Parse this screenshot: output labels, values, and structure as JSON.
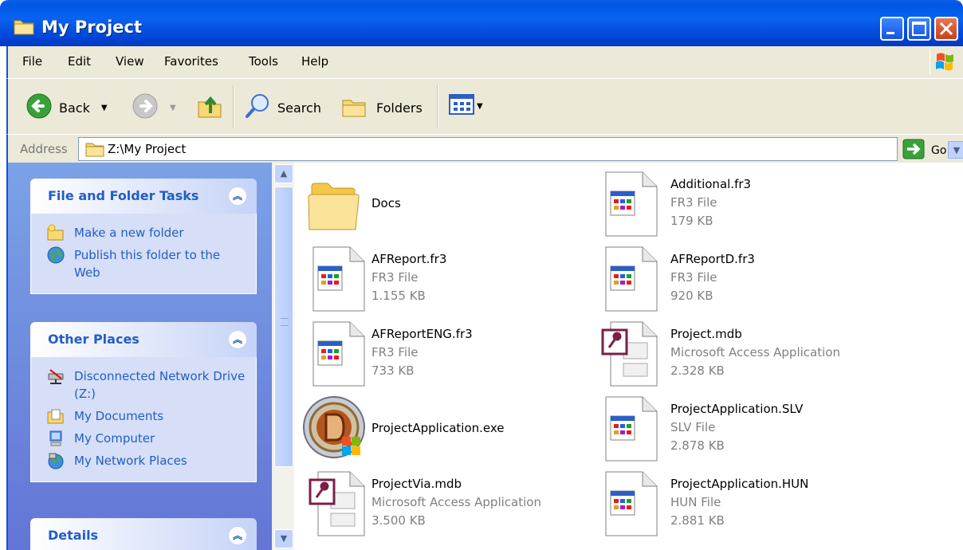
{
  "window": {
    "title": "My Project"
  },
  "menu": {
    "items": [
      "File",
      "Edit",
      "View",
      "Favorites",
      "Tools",
      "Help"
    ]
  },
  "toolbar": {
    "back_label": "Back",
    "search_label": "Search",
    "folders_label": "Folders"
  },
  "address": {
    "label": "Address",
    "value": "Z:\\My Project",
    "go_label": "Go"
  },
  "taskpane": {
    "file_tasks": {
      "title": "File and Folder Tasks",
      "items": [
        "Make a new folder",
        "Publish this folder to the Web"
      ]
    },
    "other_places": {
      "title": "Other Places",
      "items": [
        "Disconnected Network Drive (Z:)",
        "My Documents",
        "My Computer",
        "My Network Places"
      ]
    },
    "details": {
      "title": "Details"
    }
  },
  "files": [
    {
      "name": "Docs",
      "kind": "folder"
    },
    {
      "name": "Additional.fr3",
      "type": "FR3 File",
      "size": "179 KB",
      "kind": "fr3"
    },
    {
      "name": "AFReport.fr3",
      "type": "FR3 File",
      "size": "1.155 KB",
      "kind": "fr3"
    },
    {
      "name": "AFReportD.fr3",
      "type": "FR3 File",
      "size": "920 KB",
      "kind": "fr3"
    },
    {
      "name": "AFReportENG.fr3",
      "type": "FR3 File",
      "size": "733 KB",
      "kind": "fr3"
    },
    {
      "name": "Project.mdb",
      "type": "Microsoft Access Application",
      "size": "2.328 KB",
      "kind": "mdb"
    },
    {
      "name": "ProjectApplication.exe",
      "kind": "exe"
    },
    {
      "name": "ProjectApplication.SLV",
      "type": "SLV File",
      "size": "2.878 KB",
      "kind": "fr3"
    },
    {
      "name": "ProjectVia.mdb",
      "type": "Microsoft Access Application",
      "size": "3.500 KB",
      "kind": "mdb"
    },
    {
      "name": "ProjectApplication.HUN",
      "type": "HUN File",
      "size": "2.881 KB",
      "kind": "fr3"
    }
  ],
  "colors": {
    "titlebar": "#0054e3",
    "taskpane_bg": "#7ba2e7",
    "task_link": "#215dc6",
    "subtext": "#808080"
  }
}
